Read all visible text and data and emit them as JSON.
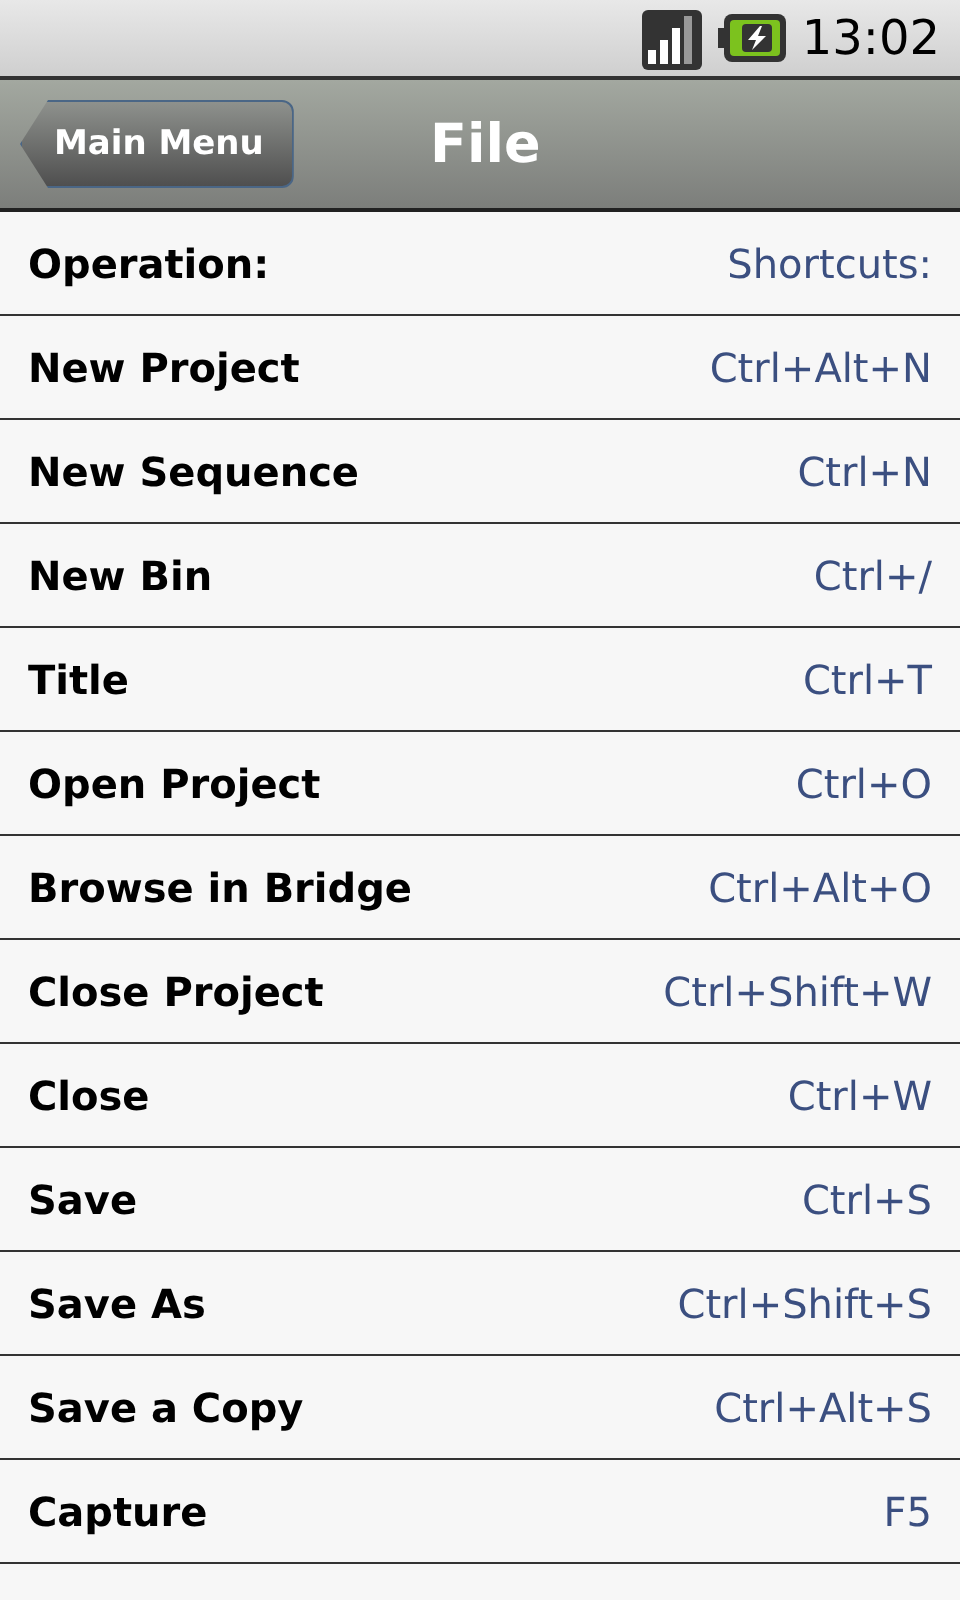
{
  "status_bar": {
    "time": "13:02"
  },
  "header": {
    "back_button": "Main Menu",
    "title": "File"
  },
  "list_heading": {
    "left": "Operation:",
    "right": "Shortcuts:"
  },
  "rows": [
    {
      "operation": "New Project",
      "shortcut": "Ctrl+Alt+N"
    },
    {
      "operation": "New Sequence",
      "shortcut": "Ctrl+N"
    },
    {
      "operation": "New Bin",
      "shortcut": "Ctrl+/"
    },
    {
      "operation": "Title",
      "shortcut": "Ctrl+T"
    },
    {
      "operation": "Open Project",
      "shortcut": "Ctrl+O"
    },
    {
      "operation": "Browse in Bridge",
      "shortcut": "Ctrl+Alt+O"
    },
    {
      "operation": "Close Project",
      "shortcut": "Ctrl+Shift+W"
    },
    {
      "operation": "Close",
      "shortcut": "Ctrl+W"
    },
    {
      "operation": "Save",
      "shortcut": "Ctrl+S"
    },
    {
      "operation": "Save As",
      "shortcut": "Ctrl+Shift+S"
    },
    {
      "operation": "Save a Copy",
      "shortcut": "Ctrl+Alt+S"
    },
    {
      "operation": "Capture",
      "shortcut": "F5"
    }
  ]
}
